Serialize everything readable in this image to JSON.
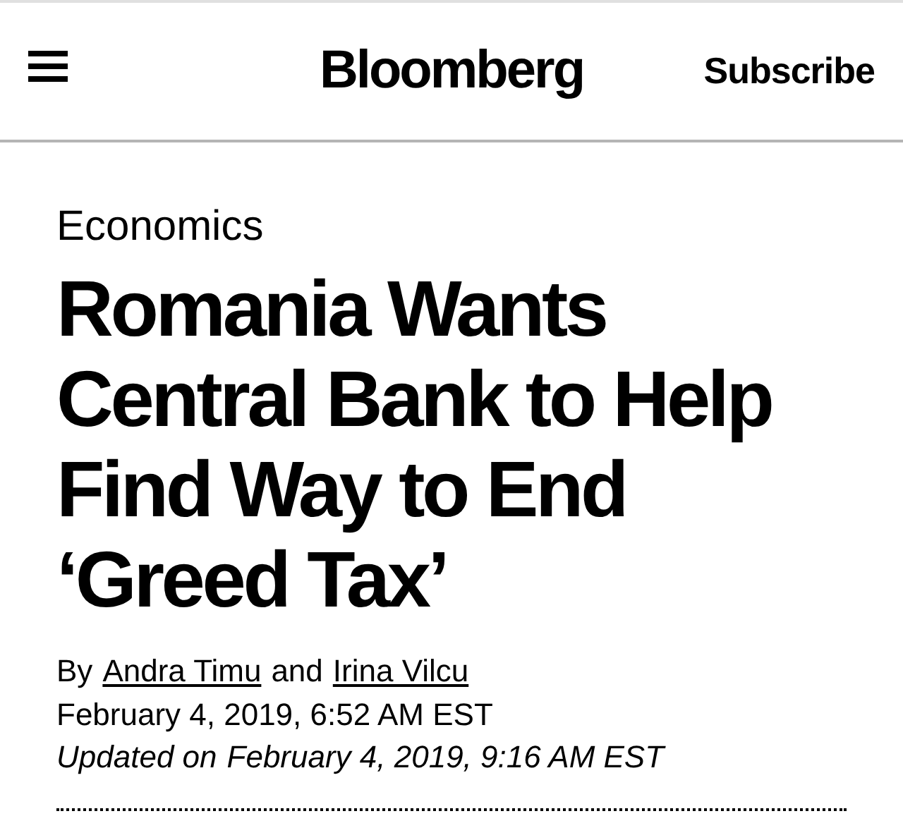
{
  "header": {
    "logo": "Bloomberg",
    "subscribe": "Subscribe"
  },
  "article": {
    "section": "Economics",
    "headline": "Romania Wants Central Bank to Help Find Way to End ‘Greed Tax’",
    "byline": {
      "prefix": "By",
      "authors": [
        "Andra Timu",
        "Irina Vilcu"
      ],
      "joiner": "and"
    },
    "published": "February 4, 2019, 6:52 AM EST",
    "updated": {
      "label": "Updated on",
      "date": "February 4, 2019, 9:16 AM EST"
    }
  }
}
